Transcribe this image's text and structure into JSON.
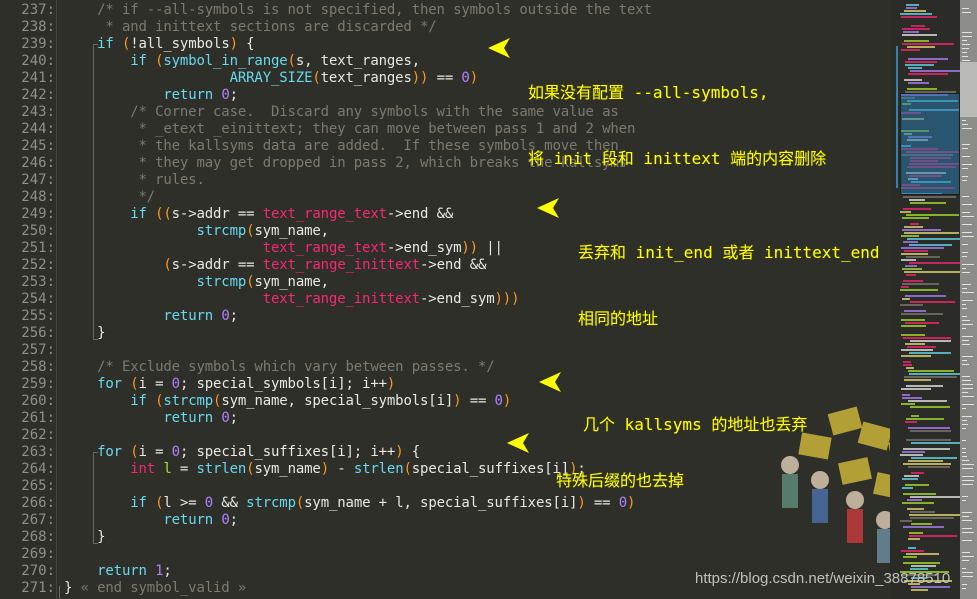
{
  "editor": {
    "theme_colors": {
      "background": "#2f2f2a",
      "comment": "#7c7a6f",
      "keyword": "#66d9ef",
      "paren": "#fd971f",
      "number": "#ae81ff",
      "macro": "#f92672",
      "identifier": "#e8e8e2",
      "line_number": "#8f908a",
      "annotation": "#ffff00"
    },
    "lines": [
      {
        "n": "237:",
        "tokens": [
          [
            "cm",
            "    /* if --all-symbols is not specified, then symbols outside the text"
          ]
        ]
      },
      {
        "n": "238:",
        "tokens": [
          [
            "cm",
            "     * and inittext sections are discarded */"
          ]
        ]
      },
      {
        "n": "239:",
        "tokens": [
          [
            "id",
            "    "
          ],
          [
            "kw",
            "if"
          ],
          [
            "id",
            " "
          ],
          [
            "pn",
            "("
          ],
          [
            "id",
            "!all_symbols"
          ],
          [
            "pn",
            ")"
          ],
          [
            "id",
            " {"
          ]
        ]
      },
      {
        "n": "240:",
        "tokens": [
          [
            "id",
            "        "
          ],
          [
            "kw",
            "if"
          ],
          [
            "id",
            " "
          ],
          [
            "pn",
            "("
          ],
          [
            "fn",
            "symbol_in_range"
          ],
          [
            "pn",
            "("
          ],
          [
            "id",
            "s, text_ranges,"
          ]
        ]
      },
      {
        "n": "241:",
        "tokens": [
          [
            "id",
            "                    "
          ],
          [
            "fn",
            "ARRAY_SIZE"
          ],
          [
            "pn",
            "("
          ],
          [
            "id",
            "text_ranges"
          ],
          [
            "pn",
            "))"
          ],
          [
            "id",
            " == "
          ],
          [
            "nm",
            "0"
          ],
          [
            "pn",
            ")"
          ]
        ]
      },
      {
        "n": "242:",
        "tokens": [
          [
            "id",
            "            "
          ],
          [
            "kw",
            "return"
          ],
          [
            "id",
            " "
          ],
          [
            "nm",
            "0"
          ],
          [
            "id",
            ";"
          ]
        ]
      },
      {
        "n": "243:",
        "tokens": [
          [
            "cm",
            "        /* Corner case.  Discard any symbols with the same value as"
          ]
        ]
      },
      {
        "n": "244:",
        "tokens": [
          [
            "cm",
            "         * _etext _einittext; they can move between pass 1 and 2 when"
          ]
        ]
      },
      {
        "n": "245:",
        "tokens": [
          [
            "cm",
            "         * the kallsyms data are added.  If these symbols move then"
          ]
        ]
      },
      {
        "n": "246:",
        "tokens": [
          [
            "cm",
            "         * they may get dropped in pass 2, which breaks the kallsyms"
          ]
        ]
      },
      {
        "n": "247:",
        "tokens": [
          [
            "cm",
            "         * rules."
          ]
        ]
      },
      {
        "n": "248:",
        "tokens": [
          [
            "cm",
            "         */"
          ]
        ]
      },
      {
        "n": "249:",
        "tokens": [
          [
            "id",
            "        "
          ],
          [
            "kw",
            "if"
          ],
          [
            "id",
            " "
          ],
          [
            "pn",
            "(("
          ],
          [
            "id",
            "s->addr == "
          ],
          [
            "mg",
            "text_range_text"
          ],
          [
            "id",
            "->end &&"
          ]
        ]
      },
      {
        "n": "250:",
        "tokens": [
          [
            "id",
            "                "
          ],
          [
            "fn",
            "strcmp"
          ],
          [
            "pn",
            "("
          ],
          [
            "id",
            "sym_name,"
          ]
        ]
      },
      {
        "n": "251:",
        "tokens": [
          [
            "id",
            "                        "
          ],
          [
            "mg",
            "text_range_text"
          ],
          [
            "id",
            "->end_sym"
          ],
          [
            "pn",
            "))"
          ],
          [
            "id",
            " ||"
          ]
        ]
      },
      {
        "n": "252:",
        "tokens": [
          [
            "id",
            "            "
          ],
          [
            "pn",
            "("
          ],
          [
            "id",
            "s->addr == "
          ],
          [
            "mg",
            "text_range_inittext"
          ],
          [
            "id",
            "->end &&"
          ]
        ]
      },
      {
        "n": "253:",
        "tokens": [
          [
            "id",
            "                "
          ],
          [
            "fn",
            "strcmp"
          ],
          [
            "pn",
            "("
          ],
          [
            "id",
            "sym_name,"
          ]
        ]
      },
      {
        "n": "254:",
        "tokens": [
          [
            "id",
            "                        "
          ],
          [
            "mg",
            "text_range_inittext"
          ],
          [
            "id",
            "->end_sym"
          ],
          [
            "pn",
            ")))"
          ]
        ]
      },
      {
        "n": "255:",
        "tokens": [
          [
            "id",
            "            "
          ],
          [
            "kw",
            "return"
          ],
          [
            "id",
            " "
          ],
          [
            "nm",
            "0"
          ],
          [
            "id",
            ";"
          ]
        ]
      },
      {
        "n": "256:",
        "tokens": [
          [
            "id",
            "    }"
          ]
        ]
      },
      {
        "n": "257:",
        "tokens": []
      },
      {
        "n": "258:",
        "tokens": [
          [
            "cm",
            "    /* Exclude symbols which vary between passes. */"
          ]
        ]
      },
      {
        "n": "259:",
        "tokens": [
          [
            "id",
            "    "
          ],
          [
            "kw",
            "for"
          ],
          [
            "id",
            " "
          ],
          [
            "pn",
            "("
          ],
          [
            "id",
            "i = "
          ],
          [
            "nm",
            "0"
          ],
          [
            "id",
            "; special_symbols[i]; i++"
          ],
          [
            "pn",
            ")"
          ]
        ]
      },
      {
        "n": "260:",
        "tokens": [
          [
            "id",
            "        "
          ],
          [
            "kw",
            "if"
          ],
          [
            "id",
            " "
          ],
          [
            "pn",
            "("
          ],
          [
            "fn",
            "strcmp"
          ],
          [
            "pn",
            "("
          ],
          [
            "id",
            "sym_name, special_symbols[i]"
          ],
          [
            "pn",
            ")"
          ],
          [
            "id",
            " == "
          ],
          [
            "nm",
            "0"
          ],
          [
            "pn",
            ")"
          ]
        ]
      },
      {
        "n": "261:",
        "tokens": [
          [
            "id",
            "            "
          ],
          [
            "kw",
            "return"
          ],
          [
            "id",
            " "
          ],
          [
            "nm",
            "0"
          ],
          [
            "id",
            ";"
          ]
        ]
      },
      {
        "n": "262:",
        "tokens": []
      },
      {
        "n": "263:",
        "tokens": [
          [
            "id",
            "    "
          ],
          [
            "kw",
            "for"
          ],
          [
            "id",
            " "
          ],
          [
            "pn",
            "("
          ],
          [
            "id",
            "i = "
          ],
          [
            "nm",
            "0"
          ],
          [
            "id",
            "; special_suffixes[i]; i++"
          ],
          [
            "pn",
            ")"
          ],
          [
            "id",
            " {"
          ]
        ]
      },
      {
        "n": "264:",
        "tokens": [
          [
            "id",
            "        "
          ],
          [
            "ty",
            "int"
          ],
          [
            "id",
            " "
          ],
          [
            "gr",
            "l"
          ],
          [
            "id",
            " = "
          ],
          [
            "fn",
            "strlen"
          ],
          [
            "pn",
            "("
          ],
          [
            "id",
            "sym_name"
          ],
          [
            "pn",
            ")"
          ],
          [
            "id",
            " - "
          ],
          [
            "fn",
            "strlen"
          ],
          [
            "pn",
            "("
          ],
          [
            "id",
            "special_suffixes[i]"
          ],
          [
            "pn",
            ")"
          ],
          [
            "id",
            ";"
          ]
        ]
      },
      {
        "n": "265:",
        "tokens": []
      },
      {
        "n": "266:",
        "tokens": [
          [
            "id",
            "        "
          ],
          [
            "kw",
            "if"
          ],
          [
            "id",
            " "
          ],
          [
            "pn",
            "("
          ],
          [
            "id",
            "l >= "
          ],
          [
            "nm",
            "0"
          ],
          [
            "id",
            " && "
          ],
          [
            "fn",
            "strcmp"
          ],
          [
            "pn",
            "("
          ],
          [
            "id",
            "sym_name + l, special_suffixes[i]"
          ],
          [
            "pn",
            ")"
          ],
          [
            "id",
            " == "
          ],
          [
            "nm",
            "0"
          ],
          [
            "pn",
            ")"
          ]
        ]
      },
      {
        "n": "267:",
        "tokens": [
          [
            "id",
            "            "
          ],
          [
            "kw",
            "return"
          ],
          [
            "id",
            " "
          ],
          [
            "nm",
            "0"
          ],
          [
            "id",
            ";"
          ]
        ]
      },
      {
        "n": "268:",
        "tokens": [
          [
            "id",
            "    }"
          ]
        ]
      },
      {
        "n": "269:",
        "tokens": []
      },
      {
        "n": "270:",
        "tokens": [
          [
            "id",
            "    "
          ],
          [
            "kw",
            "return"
          ],
          [
            "id",
            " "
          ],
          [
            "nm",
            "1"
          ],
          [
            "id",
            ";"
          ]
        ]
      },
      {
        "n": "271:",
        "tokens": [
          [
            "id",
            "} "
          ],
          [
            "cm",
            "« end symbol_valid »"
          ]
        ]
      }
    ]
  },
  "annotations": [
    {
      "lines": [
        "如果没有配置 --all-symbols,",
        "将 init 段和 inittext 端的内容删除"
      ]
    },
    {
      "lines": [
        "丢弃和 init_end 或者 inittext_end",
        "相同的地址"
      ]
    },
    {
      "lines": [
        "几个 kallsyms 的地址也丢弃"
      ]
    },
    {
      "lines": [
        "特殊后缀的也去掉"
      ]
    }
  ],
  "watermark": "https://blog.csdn.net/weixin_38878510",
  "icons": {
    "arrow": "left-pointing-arrow",
    "illustration": "crowd-holding-signs-illustration"
  }
}
